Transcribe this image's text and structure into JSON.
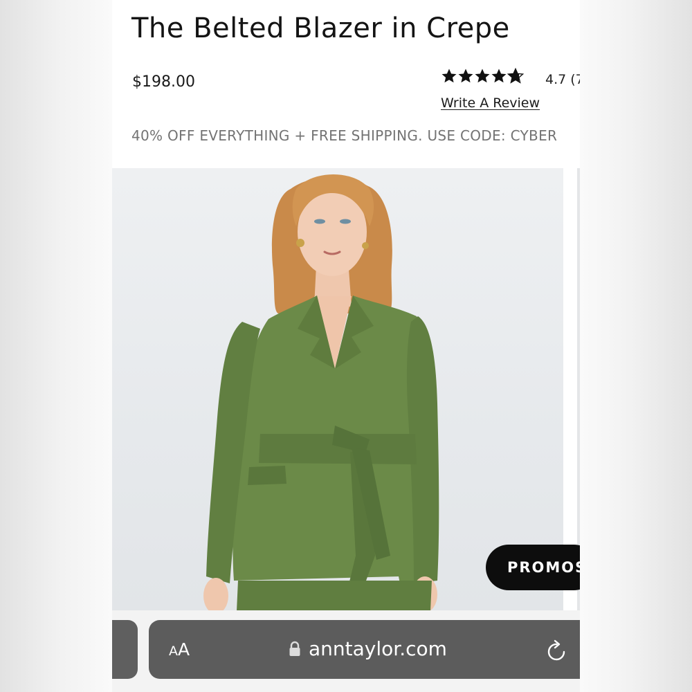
{
  "product": {
    "title": "The Belted Blazer in Crepe",
    "price": "$198.00",
    "rating_text": "4.7 (7",
    "rating_value": 4.7,
    "review_link": "Write A Review",
    "promo_banner": "40% OFF EVERYTHING + FREE SHIPPING. USE CODE: CYBER"
  },
  "image": {
    "subject": "woman-in-green-belted-blazer",
    "jacket_color": "#6b8a48",
    "background_color": "#e8eaed"
  },
  "floating_button": {
    "label": "PROMOS"
  },
  "browser": {
    "text_size_label": "A",
    "text_size_label_large": "A",
    "url": "anntaylor.com",
    "lock_icon": "lock-icon",
    "reload_icon": "reload-icon"
  },
  "colors": {
    "bar_background": "#5c5c5c",
    "promo_text": "#737373",
    "button_background": "#0d0d0d"
  }
}
